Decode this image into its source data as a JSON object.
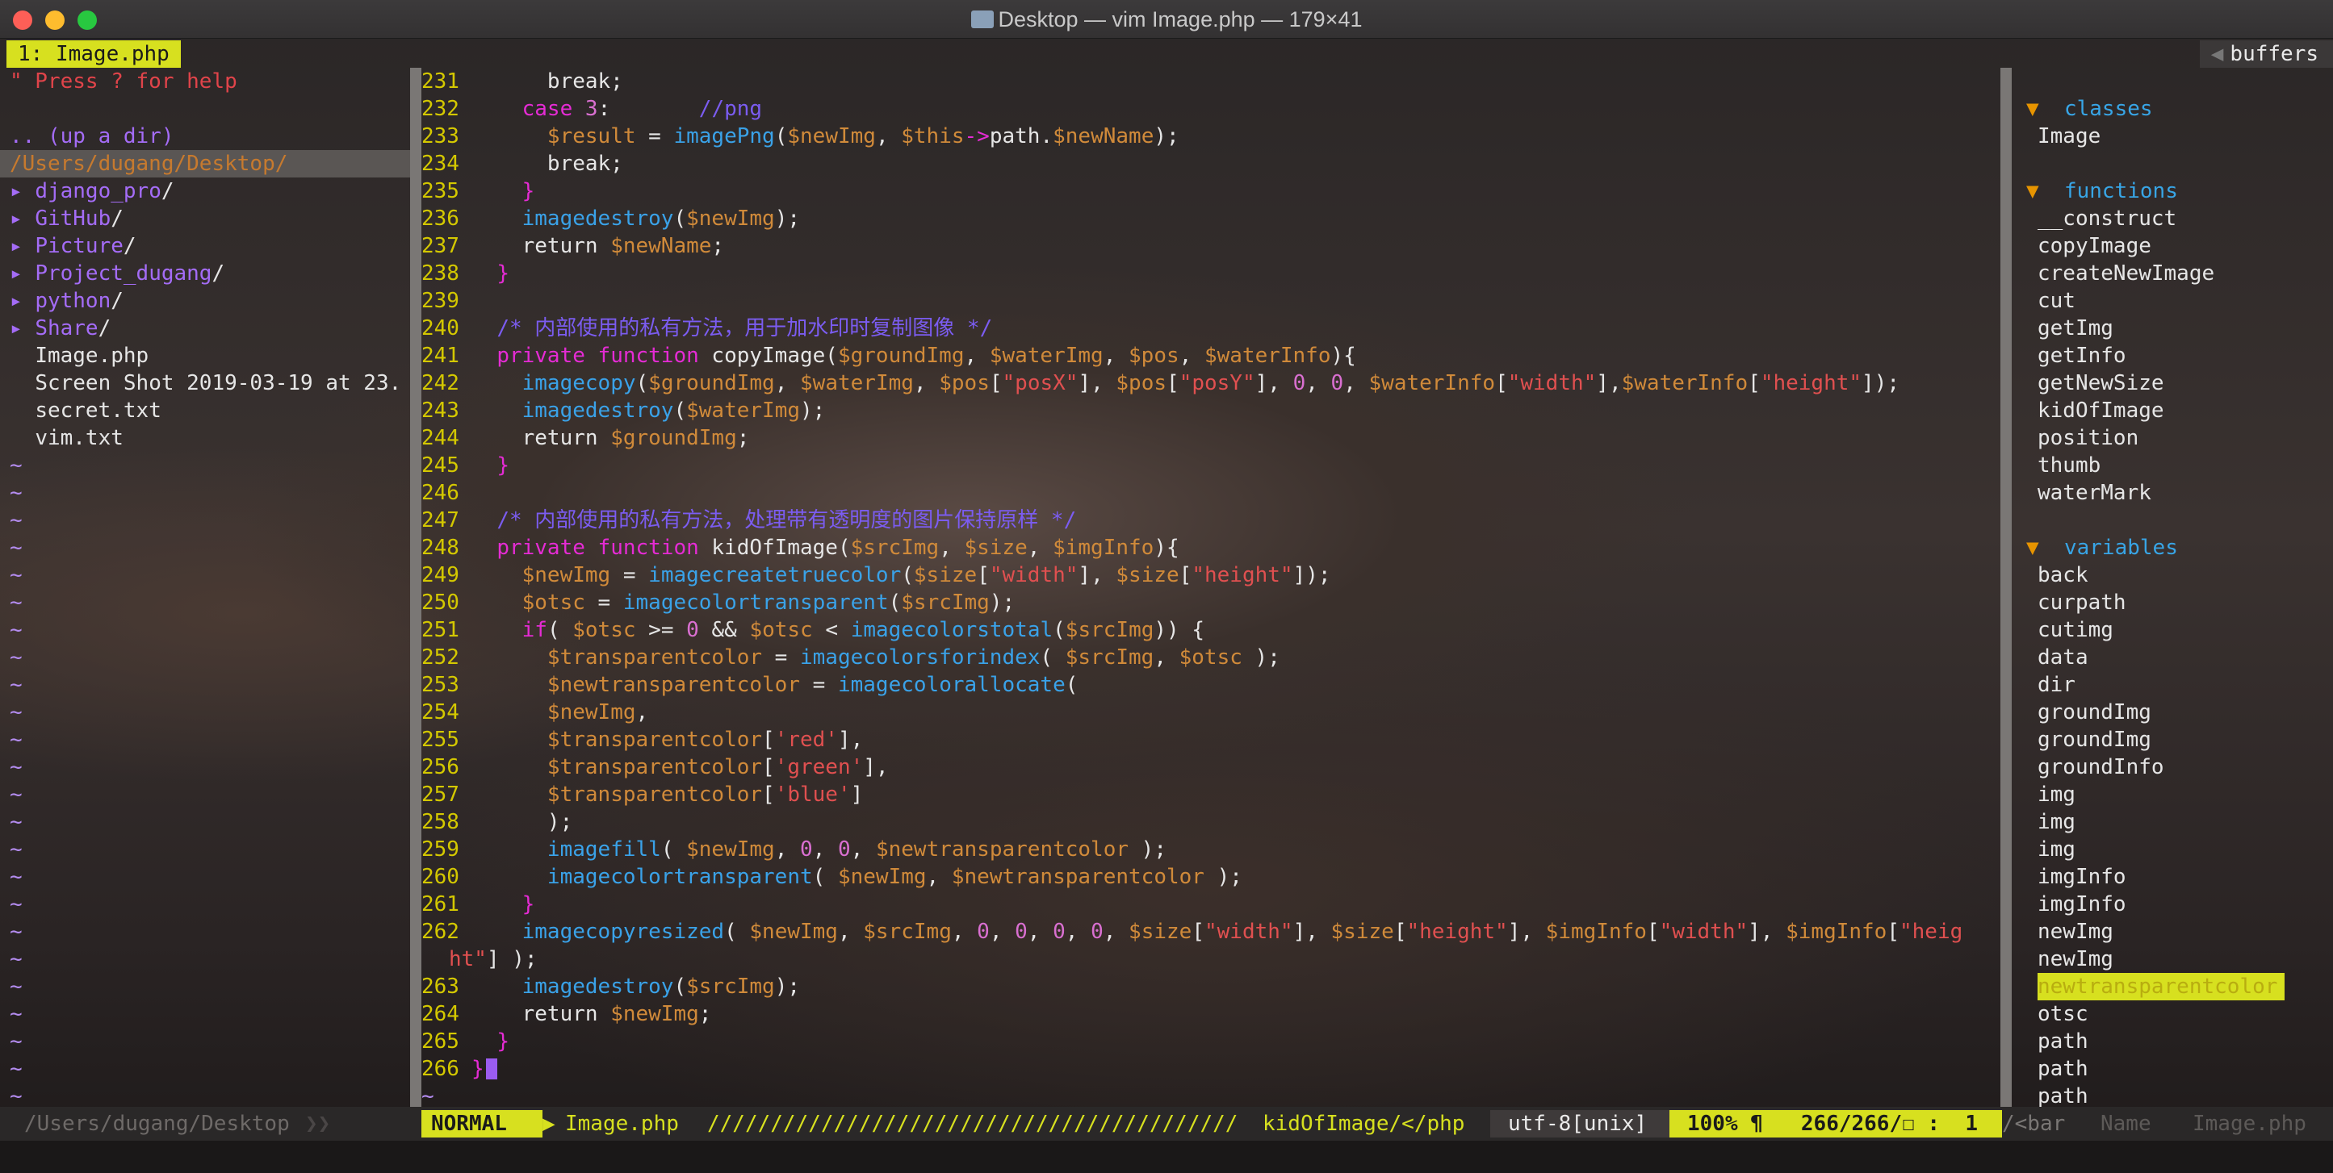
{
  "window": {
    "title": "Desktop — vim Image.php — 179×41"
  },
  "tabline": {
    "active_tab": "1: Image.php",
    "right_label": "buffers"
  },
  "tree": {
    "help": "\" Press ? for help",
    "up": ".. (up a dir)",
    "cwd": "/Users/dugang/Desktop/",
    "entries": [
      {
        "arrow": "▸ ",
        "name": "django_pro",
        "slash": "/"
      },
      {
        "arrow": "▸ ",
        "name": "GitHub",
        "slash": "/"
      },
      {
        "arrow": "▸ ",
        "name": "Picture",
        "slash": "/"
      },
      {
        "arrow": "▸ ",
        "name": "Project_dugang",
        "slash": "/"
      },
      {
        "arrow": "▸ ",
        "name": "python",
        "slash": "/"
      },
      {
        "arrow": "▸ ",
        "name": "Share",
        "slash": "/"
      },
      {
        "arrow": "  ",
        "name": "Image.php",
        "slash": ""
      },
      {
        "arrow": "  ",
        "name": "Screen Shot 2019-03-19 at 23.",
        "slash": ""
      },
      {
        "arrow": "  ",
        "name": "secret.txt",
        "slash": ""
      },
      {
        "arrow": "  ",
        "name": "vim.txt",
        "slash": ""
      }
    ],
    "tilde": "~"
  },
  "code": {
    "lines": [
      {
        "n": "231",
        "t": [
          [
            "plain",
            "      break;"
          ]
        ]
      },
      {
        "n": "232",
        "t": [
          [
            "plain",
            "    "
          ],
          [
            "kw",
            "case"
          ],
          [
            "plain",
            " "
          ],
          [
            "num",
            "3"
          ],
          [
            "plain",
            ":       "
          ],
          [
            "cmt",
            "//png"
          ]
        ]
      },
      {
        "n": "233",
        "t": [
          [
            "plain",
            "      "
          ],
          [
            "var",
            "$result"
          ],
          [
            "plain",
            " = "
          ],
          [
            "fn",
            "imagePng"
          ],
          [
            "plain",
            "("
          ],
          [
            "var",
            "$newImg"
          ],
          [
            "plain",
            ", "
          ],
          [
            "var",
            "$this"
          ],
          [
            "kw",
            "->"
          ],
          [
            "plain",
            "path."
          ],
          [
            "var",
            "$newName"
          ],
          [
            "plain",
            ");"
          ]
        ]
      },
      {
        "n": "234",
        "t": [
          [
            "plain",
            "      break;"
          ]
        ]
      },
      {
        "n": "235",
        "t": [
          [
            "plain",
            "    "
          ],
          [
            "kw",
            "}"
          ]
        ]
      },
      {
        "n": "236",
        "t": [
          [
            "plain",
            "    "
          ],
          [
            "fn",
            "imagedestroy"
          ],
          [
            "plain",
            "("
          ],
          [
            "var",
            "$newImg"
          ],
          [
            "plain",
            ");"
          ]
        ]
      },
      {
        "n": "237",
        "t": [
          [
            "plain",
            "    return "
          ],
          [
            "var",
            "$newName"
          ],
          [
            "plain",
            ";"
          ]
        ]
      },
      {
        "n": "238",
        "t": [
          [
            "plain",
            "  "
          ],
          [
            "kw",
            "}"
          ]
        ]
      },
      {
        "n": "239",
        "t": [
          [
            "plain",
            ""
          ]
        ]
      },
      {
        "n": "240",
        "t": [
          [
            "plain",
            "  "
          ],
          [
            "cmt",
            "/* 内部使用的私有方法，用于加水印时复制图像 */"
          ]
        ]
      },
      {
        "n": "241",
        "t": [
          [
            "plain",
            "  "
          ],
          [
            "kw",
            "private function"
          ],
          [
            "plain",
            " copyImage("
          ],
          [
            "var",
            "$groundImg"
          ],
          [
            "plain",
            ", "
          ],
          [
            "var",
            "$waterImg"
          ],
          [
            "plain",
            ", "
          ],
          [
            "var",
            "$pos"
          ],
          [
            "plain",
            ", "
          ],
          [
            "var",
            "$waterInfo"
          ],
          [
            "plain",
            "){"
          ]
        ]
      },
      {
        "n": "242",
        "t": [
          [
            "plain",
            "    "
          ],
          [
            "fn",
            "imagecopy"
          ],
          [
            "plain",
            "("
          ],
          [
            "var",
            "$groundImg"
          ],
          [
            "plain",
            ", "
          ],
          [
            "var",
            "$waterImg"
          ],
          [
            "plain",
            ", "
          ],
          [
            "var",
            "$pos"
          ],
          [
            "plain",
            "["
          ],
          [
            "str",
            "\"posX\""
          ],
          [
            "plain",
            "], "
          ],
          [
            "var",
            "$pos"
          ],
          [
            "plain",
            "["
          ],
          [
            "str",
            "\"posY\""
          ],
          [
            "plain",
            "], "
          ],
          [
            "num",
            "0"
          ],
          [
            "plain",
            ", "
          ],
          [
            "num",
            "0"
          ],
          [
            "plain",
            ", "
          ],
          [
            "var",
            "$waterInfo"
          ],
          [
            "plain",
            "["
          ],
          [
            "str",
            "\"width\""
          ],
          [
            "plain",
            "],"
          ],
          [
            "var",
            "$waterInfo"
          ],
          [
            "plain",
            "["
          ],
          [
            "str",
            "\"height\""
          ],
          [
            "plain",
            "]);"
          ]
        ]
      },
      {
        "n": "243",
        "t": [
          [
            "plain",
            "    "
          ],
          [
            "fn",
            "imagedestroy"
          ],
          [
            "plain",
            "("
          ],
          [
            "var",
            "$waterImg"
          ],
          [
            "plain",
            ");"
          ]
        ]
      },
      {
        "n": "244",
        "t": [
          [
            "plain",
            "    return "
          ],
          [
            "var",
            "$groundImg"
          ],
          [
            "plain",
            ";"
          ]
        ]
      },
      {
        "n": "245",
        "t": [
          [
            "plain",
            "  "
          ],
          [
            "kw",
            "}"
          ]
        ]
      },
      {
        "n": "246",
        "t": [
          [
            "plain",
            ""
          ]
        ]
      },
      {
        "n": "247",
        "t": [
          [
            "plain",
            "  "
          ],
          [
            "cmt",
            "/* 内部使用的私有方法，处理带有透明度的图片保持原样 */"
          ]
        ]
      },
      {
        "n": "248",
        "t": [
          [
            "plain",
            "  "
          ],
          [
            "kw",
            "private function"
          ],
          [
            "plain",
            " kidOfImage("
          ],
          [
            "var",
            "$srcImg"
          ],
          [
            "plain",
            ", "
          ],
          [
            "var",
            "$size"
          ],
          [
            "plain",
            ", "
          ],
          [
            "var",
            "$imgInfo"
          ],
          [
            "plain",
            "){"
          ]
        ]
      },
      {
        "n": "249",
        "t": [
          [
            "plain",
            "    "
          ],
          [
            "var",
            "$newImg"
          ],
          [
            "plain",
            " = "
          ],
          [
            "fn",
            "imagecreatetruecolor"
          ],
          [
            "plain",
            "("
          ],
          [
            "var",
            "$size"
          ],
          [
            "plain",
            "["
          ],
          [
            "str",
            "\"width\""
          ],
          [
            "plain",
            "], "
          ],
          [
            "var",
            "$size"
          ],
          [
            "plain",
            "["
          ],
          [
            "str",
            "\"height\""
          ],
          [
            "plain",
            "]);"
          ]
        ]
      },
      {
        "n": "250",
        "t": [
          [
            "plain",
            "    "
          ],
          [
            "var",
            "$otsc"
          ],
          [
            "plain",
            " = "
          ],
          [
            "fn",
            "imagecolortransparent"
          ],
          [
            "plain",
            "("
          ],
          [
            "var",
            "$srcImg"
          ],
          [
            "plain",
            ");"
          ]
        ]
      },
      {
        "n": "251",
        "t": [
          [
            "plain",
            "    "
          ],
          [
            "kw",
            "if"
          ],
          [
            "plain",
            "( "
          ],
          [
            "var",
            "$otsc"
          ],
          [
            "plain",
            " >= "
          ],
          [
            "num",
            "0"
          ],
          [
            "plain",
            " && "
          ],
          [
            "var",
            "$otsc"
          ],
          [
            "plain",
            " < "
          ],
          [
            "fn",
            "imagecolorstotal"
          ],
          [
            "plain",
            "("
          ],
          [
            "var",
            "$srcImg"
          ],
          [
            "plain",
            ")) {"
          ]
        ]
      },
      {
        "n": "252",
        "t": [
          [
            "plain",
            "      "
          ],
          [
            "var",
            "$transparentcolor"
          ],
          [
            "plain",
            " = "
          ],
          [
            "fn",
            "imagecolorsforindex"
          ],
          [
            "plain",
            "( "
          ],
          [
            "var",
            "$srcImg"
          ],
          [
            "plain",
            ", "
          ],
          [
            "var",
            "$otsc"
          ],
          [
            "plain",
            " );"
          ]
        ]
      },
      {
        "n": "253",
        "t": [
          [
            "plain",
            "      "
          ],
          [
            "var",
            "$newtransparentcolor"
          ],
          [
            "plain",
            " = "
          ],
          [
            "fn",
            "imagecolorallocate"
          ],
          [
            "plain",
            "("
          ]
        ]
      },
      {
        "n": "254",
        "t": [
          [
            "plain",
            "      "
          ],
          [
            "var",
            "$newImg"
          ],
          [
            "plain",
            ","
          ]
        ]
      },
      {
        "n": "255",
        "t": [
          [
            "plain",
            "      "
          ],
          [
            "var",
            "$transparentcolor"
          ],
          [
            "plain",
            "["
          ],
          [
            "str",
            "'red'"
          ],
          [
            "plain",
            "],"
          ]
        ]
      },
      {
        "n": "256",
        "t": [
          [
            "plain",
            "      "
          ],
          [
            "var",
            "$transparentcolor"
          ],
          [
            "plain",
            "["
          ],
          [
            "str",
            "'green'"
          ],
          [
            "plain",
            "],"
          ]
        ]
      },
      {
        "n": "257",
        "t": [
          [
            "plain",
            "      "
          ],
          [
            "var",
            "$transparentcolor"
          ],
          [
            "plain",
            "["
          ],
          [
            "str",
            "'blue'"
          ],
          [
            "plain",
            "]"
          ]
        ]
      },
      {
        "n": "258",
        "t": [
          [
            "plain",
            "      );"
          ]
        ]
      },
      {
        "n": "259",
        "t": [
          [
            "plain",
            "      "
          ],
          [
            "fn",
            "imagefill"
          ],
          [
            "plain",
            "( "
          ],
          [
            "var",
            "$newImg"
          ],
          [
            "plain",
            ", "
          ],
          [
            "num",
            "0"
          ],
          [
            "plain",
            ", "
          ],
          [
            "num",
            "0"
          ],
          [
            "plain",
            ", "
          ],
          [
            "var",
            "$newtransparentcolor"
          ],
          [
            "plain",
            " );"
          ]
        ]
      },
      {
        "n": "260",
        "t": [
          [
            "plain",
            "      "
          ],
          [
            "fn",
            "imagecolortransparent"
          ],
          [
            "plain",
            "( "
          ],
          [
            "var",
            "$newImg"
          ],
          [
            "plain",
            ", "
          ],
          [
            "var",
            "$newtransparentcolor"
          ],
          [
            "plain",
            " );"
          ]
        ]
      },
      {
        "n": "261",
        "t": [
          [
            "plain",
            "    "
          ],
          [
            "kw",
            "}"
          ]
        ]
      },
      {
        "n": "262",
        "t": [
          [
            "plain",
            "    "
          ],
          [
            "fn",
            "imagecopyresized"
          ],
          [
            "plain",
            "( "
          ],
          [
            "var",
            "$newImg"
          ],
          [
            "plain",
            ", "
          ],
          [
            "var",
            "$srcImg"
          ],
          [
            "plain",
            ", "
          ],
          [
            "num",
            "0"
          ],
          [
            "plain",
            ", "
          ],
          [
            "num",
            "0"
          ],
          [
            "plain",
            ", "
          ],
          [
            "num",
            "0"
          ],
          [
            "plain",
            ", "
          ],
          [
            "num",
            "0"
          ],
          [
            "plain",
            ", "
          ],
          [
            "var",
            "$size"
          ],
          [
            "plain",
            "["
          ],
          [
            "str",
            "\"width\""
          ],
          [
            "plain",
            "], "
          ],
          [
            "var",
            "$size"
          ],
          [
            "plain",
            "["
          ],
          [
            "str",
            "\"height\""
          ],
          [
            "plain",
            "], "
          ],
          [
            "var",
            "$imgInfo"
          ],
          [
            "plain",
            "["
          ],
          [
            "str",
            "\"width\""
          ],
          [
            "plain",
            "], "
          ],
          [
            "var",
            "$imgInfo"
          ],
          [
            "plain",
            "["
          ],
          [
            "str",
            "\"heig"
          ]
        ]
      },
      {
        "n": "",
        "t": [
          [
            "str",
            "ht\""
          ],
          [
            "plain",
            "] );"
          ]
        ]
      },
      {
        "n": "263",
        "t": [
          [
            "plain",
            "    "
          ],
          [
            "fn",
            "imagedestroy"
          ],
          [
            "plain",
            "("
          ],
          [
            "var",
            "$srcImg"
          ],
          [
            "plain",
            ");"
          ]
        ]
      },
      {
        "n": "264",
        "t": [
          [
            "plain",
            "    return "
          ],
          [
            "var",
            "$newImg"
          ],
          [
            "plain",
            ";"
          ]
        ]
      },
      {
        "n": "265",
        "t": [
          [
            "plain",
            "  "
          ],
          [
            "kw",
            "}"
          ]
        ]
      },
      {
        "n": "266",
        "t": [
          [
            "kw",
            "}"
          ]
        ]
      }
    ],
    "end_tilde": "~"
  },
  "tagbar": {
    "groups": [
      {
        "label": "classes",
        "items": [
          "Image"
        ]
      },
      {
        "label": "functions",
        "items": [
          "__construct",
          "copyImage",
          "createNewImage",
          "cut",
          "getImg",
          "getInfo",
          "getNewSize",
          "kidOfImage",
          "position",
          "thumb",
          "waterMark"
        ]
      },
      {
        "label": "variables",
        "items": [
          "back",
          "curpath",
          "cutimg",
          "data",
          "dir",
          "groundImg",
          "groundImg",
          "groundInfo",
          "img",
          "img",
          "img",
          "imgInfo",
          "imgInfo",
          "newImg",
          "newImg",
          "newtransparentcolor",
          "otsc",
          "path",
          "path",
          "path"
        ]
      }
    ],
    "highlighted": "newtransparentcolor"
  },
  "statusbar": {
    "left_path": "/Users/dugang/Desktop",
    "mode": "NORMAL",
    "filename": "Image.php",
    "filler": "//////////////////////////////////////////",
    "tag": "kidOfImage/</php",
    "encoding": "utf-8[unix]",
    "percent": "100% ¶",
    "position": "266/266/☐ :  1",
    "tagbar_hint": "/<bar",
    "name_label": "Name",
    "right_file": "Image.php"
  },
  "colors": {
    "accent": "#d7e01f",
    "keyword": "#e52bd4",
    "variable": "#d08a3a",
    "function": "#3aa2e8",
    "string": "#e05050",
    "comment": "#7b5cf0",
    "linenr": "#d4c800"
  }
}
